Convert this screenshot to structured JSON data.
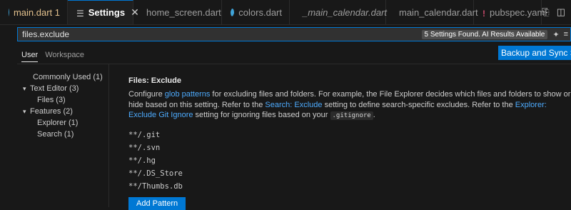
{
  "tabs": [
    {
      "label": "main.dart 1",
      "icon": "dart-icon",
      "modified": true
    },
    {
      "label": "Settings",
      "icon": "settings-icon",
      "active": true
    },
    {
      "label": "home_screen.dart",
      "icon": "dart-icon"
    },
    {
      "label": "colors.dart",
      "icon": "dart-icon"
    },
    {
      "label": "_main_calendar.dart",
      "icon": "dart-icon",
      "italic": true
    },
    {
      "label": "main_calendar.dart",
      "icon": "dart-icon"
    },
    {
      "label": "pubspec.yaml",
      "icon": "yaml-icon"
    }
  ],
  "tab_close": "✕",
  "search": {
    "value": "files.exclude",
    "result_badge": "5 Settings Found. AI Results Available"
  },
  "scope_tabs": [
    "User",
    "Workspace"
  ],
  "sync_button": "Backup and Sync Settings",
  "toc": [
    {
      "label": "Commonly Used (1)",
      "indent": 1
    },
    {
      "label": "Text Editor (3)",
      "indent": 0,
      "chevron": "▾"
    },
    {
      "label": "Files (3)",
      "indent": 2
    },
    {
      "label": "Features (2)",
      "indent": 0,
      "chevron": "▾"
    },
    {
      "label": "Explorer (1)",
      "indent": 2
    },
    {
      "label": "Search (1)",
      "indent": 2
    }
  ],
  "setting": {
    "category": "Files:",
    "name": "Exclude",
    "desc_1": "Configure ",
    "link_glob": "glob patterns",
    "desc_2": " for excluding files and folders. For example, the File Explorer decides which files and folders to show or hide based on this setting. Refer to the ",
    "link_search": "Search: Exclude",
    "desc_3": " setting to define search-specific excludes. Refer to the ",
    "link_git": "Explorer: Exclude Git Ignore",
    "desc_4": " setting for ignoring files based on your ",
    "code": ".gitignore",
    "desc_5": ".",
    "patterns": [
      "**/.git",
      "**/.svn",
      "**/.hg",
      "**/.DS_Store",
      "**/Thumbs.db"
    ],
    "add_button": "Add Pattern"
  },
  "colors": {
    "accent": "#0078d4",
    "link": "#4daafc",
    "background": "#181818"
  }
}
